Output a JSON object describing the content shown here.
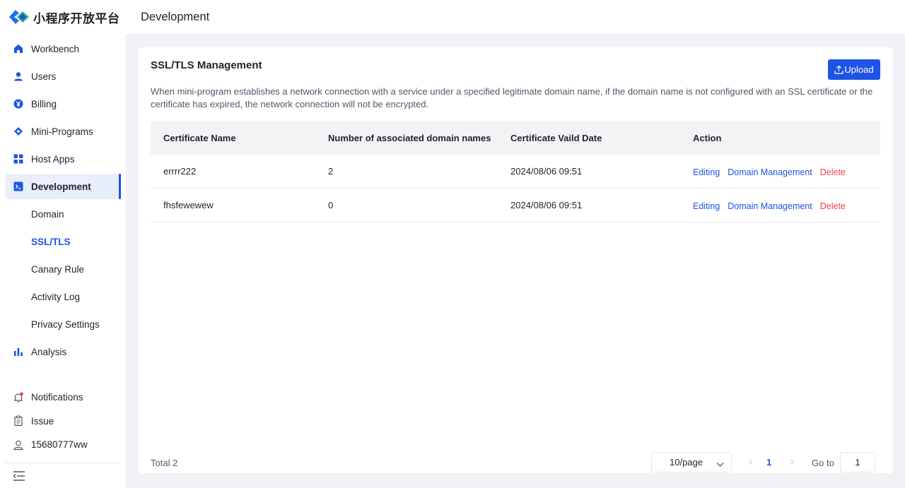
{
  "app": {
    "logo_text": "小程序开放平台"
  },
  "sidebar": {
    "items": [
      {
        "label": "Workbench",
        "icon": "home-icon"
      },
      {
        "label": "Users",
        "icon": "user-icon"
      },
      {
        "label": "Billing",
        "icon": "yen-coin-icon"
      },
      {
        "label": "Mini-Programs",
        "icon": "diamond-icon"
      },
      {
        "label": "Host Apps",
        "icon": "grid-icon"
      },
      {
        "label": "Development",
        "icon": "terminal-icon",
        "active": true
      }
    ],
    "sub_items": [
      {
        "label": "Domain"
      },
      {
        "label": "SSL/TLS",
        "active": true
      },
      {
        "label": "Canary Rule"
      },
      {
        "label": "Activity Log"
      },
      {
        "label": "Privacy Settings"
      }
    ],
    "analysis": {
      "label": "Analysis",
      "icon": "bar-chart-icon"
    },
    "bottom": {
      "notifications": "Notifications",
      "issue": "Issue",
      "user": "15680777ww"
    }
  },
  "header": {
    "title": "Development"
  },
  "card": {
    "title": "SSL/TLS Management",
    "upload_label": "Upload",
    "description": "When mini-program establishes a network connection with a service under a specified legitimate domain name, if the domain name is not configured with an SSL certificate or the certificate has expired, the network connection will not be encrypted."
  },
  "table": {
    "columns": [
      "Certificate Name",
      "Number of associated domain names",
      "Certificate Vaild Date",
      "Action"
    ],
    "rows": [
      {
        "name": "errrr222",
        "count": "2",
        "date": "2024/08/06 09:51"
      },
      {
        "name": "fhsfewewew",
        "count": "0",
        "date": "2024/08/06 09:51"
      }
    ],
    "actions": {
      "edit": "Editing",
      "domain": "Domain Management",
      "delete": "Delete"
    }
  },
  "pagination": {
    "total": "Total 2",
    "page_size": "10/page",
    "current_page": "1",
    "goto_label": "Go to",
    "goto_value": "1"
  },
  "colors": {
    "accent": "#1e53e5",
    "danger": "#f53f3f",
    "background": "#f0f2f5"
  }
}
